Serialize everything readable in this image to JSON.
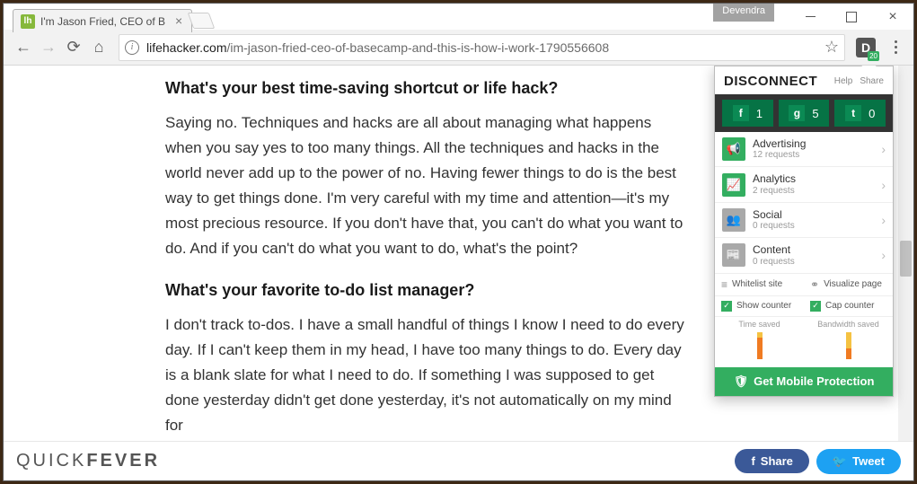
{
  "window": {
    "profile": "Devendra",
    "tab": {
      "favicon": "lh",
      "title": "I'm Jason Fried, CEO of B"
    },
    "url": {
      "host": "lifehacker.com",
      "path": "/im-jason-fried-ceo-of-basecamp-and-this-is-how-i-work-1790556608"
    },
    "ext_badge": "20"
  },
  "article": {
    "h1": "What's your best time-saving shortcut or life hack?",
    "p1": "Saying no. Techniques and hacks are all about managing what happens when you say yes to too many things. All the techniques and hacks in the world never add up to the power of no. Having fewer things to do is the best way to get things done. I'm very careful with my time and attention—it's my most precious resource. If you don't have that, you can't do what you want to do. And if you can't do what you want to do, what's the point?",
    "h2": "What's your favorite to-do list manager?",
    "p2": "I don't track to-dos. I have a small handful of things I know I need to do every day. If I can't keep them in my head, I have too many things to do. Every day is a blank slate for what I need to do. If something I was supposed to get done yesterday didn't get done yesterday, it's not automatically on my mind for"
  },
  "footer": {
    "logo1": "QUICK",
    "logo2": "FEVER",
    "share": "Share",
    "tweet": "Tweet"
  },
  "disconnect": {
    "brand": "DISCONNECT",
    "help": "Help",
    "share": "Share",
    "social": [
      {
        "icon": "f",
        "count": "1"
      },
      {
        "icon": "g",
        "count": "5"
      },
      {
        "icon": "t",
        "count": "0"
      }
    ],
    "cats": [
      {
        "name": "Advertising",
        "req": "12 requests",
        "on": true,
        "icon": "📢"
      },
      {
        "name": "Analytics",
        "req": "2 requests",
        "on": true,
        "icon": "📈"
      },
      {
        "name": "Social",
        "req": "0 requests",
        "on": false,
        "icon": "👥"
      },
      {
        "name": "Content",
        "req": "0 requests",
        "on": false,
        "icon": "📰"
      }
    ],
    "whitelist": "Whitelist site",
    "visualize": "Visualize page",
    "show_counter": "Show counter",
    "cap_counter": "Cap counter",
    "time_saved": "Time saved",
    "bandwidth_saved": "Bandwidth saved",
    "mobile": "Get Mobile Protection"
  }
}
